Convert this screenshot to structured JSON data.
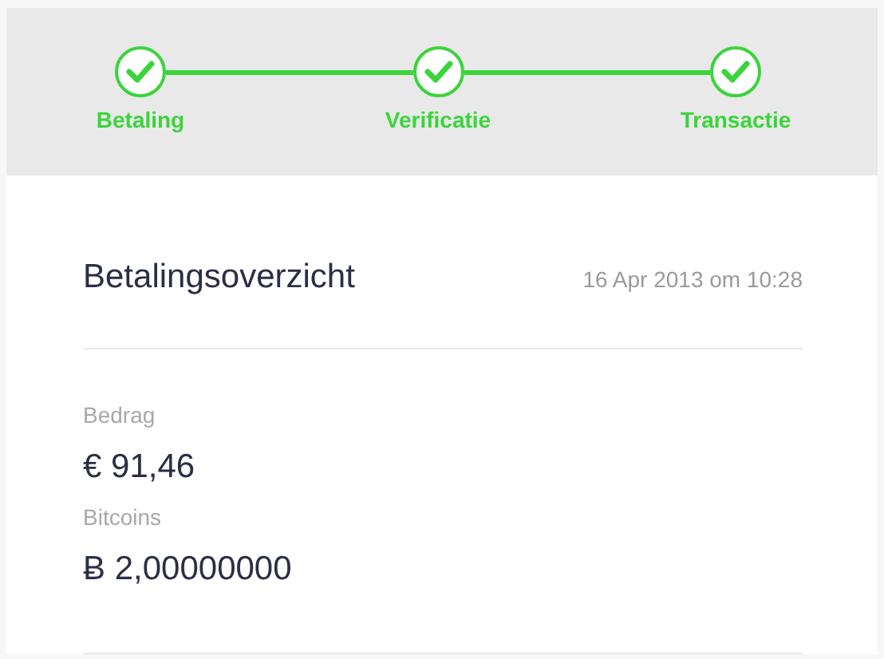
{
  "steps": [
    {
      "label": "Betaling",
      "done": true
    },
    {
      "label": "Verificatie",
      "done": true
    },
    {
      "label": "Transactie",
      "done": true
    }
  ],
  "summary": {
    "title": "Betalingsoverzicht",
    "date": "16 Apr 2013 om 10:28",
    "fields": [
      {
        "label": "Bedrag",
        "value": "€ 91,46"
      },
      {
        "label": "Bitcoins",
        "value": "Ƀ 2,00000000"
      }
    ]
  }
}
